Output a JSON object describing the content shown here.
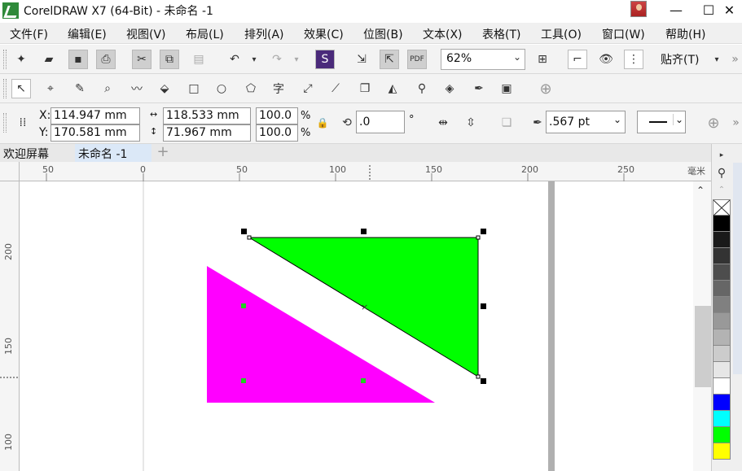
{
  "window": {
    "title": "CorelDRAW X7 (64-Bit) - 未命名 -1",
    "minimize_glyph": "—",
    "maximize_glyph": "☐",
    "close_glyph": "✕"
  },
  "menu": [
    "文件(F)",
    "编辑(E)",
    "视图(V)",
    "布局(L)",
    "排列(A)",
    "效果(C)",
    "位图(B)",
    "文本(X)",
    "表格(T)",
    "工具(O)",
    "窗口(W)",
    "帮助(H)"
  ],
  "standard_toolbar": {
    "zoom_level": "62%",
    "snap_label": "贴齐(T)"
  },
  "property_bar": {
    "x_label": "X:",
    "y_label": "Y:",
    "x_value": "114.947 mm",
    "y_value": "170.581 mm",
    "width_value": "118.533 mm",
    "height_value": "71.967 mm",
    "scale_x": "100.0",
    "scale_y": "100.0",
    "percent": "%",
    "rotation": ".0",
    "degree": "°",
    "outline_width": ".567 pt"
  },
  "tabs": {
    "welcome": "欢迎屏幕",
    "document": "未命名 -1",
    "add": "+"
  },
  "ruler": {
    "unit": "毫米",
    "h_ticks": [
      "50",
      "0",
      "50",
      "100",
      "150",
      "200",
      "250"
    ],
    "v_ticks": [
      "200",
      "150",
      "100"
    ]
  },
  "colors": {
    "green_shape": "#00ff00",
    "magenta_shape": "#ff00ff",
    "palette": [
      "#000000",
      "#1a1a1a",
      "#333333",
      "#4d4d4d",
      "#666666",
      "#808080",
      "#999999",
      "#b3b3b3",
      "#cccccc",
      "#e6e6e6",
      "#ffffff",
      "#0000ff",
      "#00ffff",
      "#00ff00",
      "#ffff00"
    ]
  }
}
